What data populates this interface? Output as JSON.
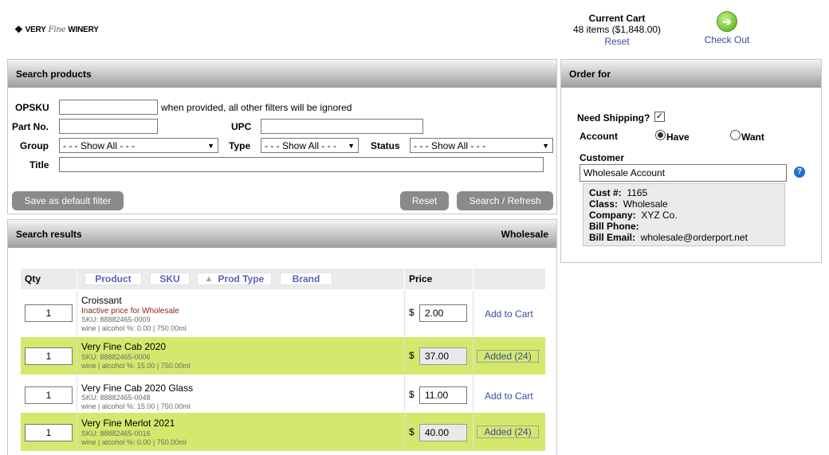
{
  "brand": {
    "logo_text_1": "VERY",
    "logo_text_2": "Fine",
    "logo_text_3": "WINERY"
  },
  "cart": {
    "title": "Current Cart",
    "summary": "48 items ($1,848.00)",
    "reset": "Reset"
  },
  "checkout": {
    "label": "Check Out",
    "icon": "arrow-right-circle-icon"
  },
  "search": {
    "title": "Search products",
    "opsku_label": "OPSKU",
    "opsku_value": "",
    "opsku_note": "when provided, all other filters will be ignored",
    "partno_label": "Part No.",
    "partno_value": "",
    "upc_label": "UPC",
    "upc_value": "",
    "group_label": "Group",
    "group_value": "- - - Show All - - -",
    "type_label": "Type",
    "type_value": "- - - Show All - - -",
    "status_label": "Status",
    "status_value": "- - - Show All - - -",
    "title_label": "Title",
    "title_value": "",
    "save_default": "Save as default filter",
    "reset": "Reset",
    "search_refresh": "Search / Refresh"
  },
  "results": {
    "title": "Search results",
    "pricing": "Wholesale",
    "columns": {
      "qty": "Qty",
      "product": "Product",
      "sku": "SKU",
      "prod_type": "Prod Type",
      "brand": "Brand",
      "price": "Price"
    },
    "rows": [
      {
        "qty": "1",
        "name": "Croissant",
        "note": "Inactive price for Wholesale",
        "sku": "SKU: 88882465-0009",
        "meta": "wine | alcohol %: 0.00 | 750.00ml",
        "currency": "$",
        "price": "2.00",
        "action": "Add to Cart"
      },
      {
        "qty": "1",
        "name": "Very Fine Cab 2020",
        "sku": "SKU: 88882465-0006",
        "meta": "wine | alcohol %: 15.00 | 750.00ml",
        "currency": "$",
        "price": "37.00",
        "action": "Added (24)"
      },
      {
        "qty": "1",
        "name": "Very Fine Cab 2020 Glass",
        "sku": "SKU: 88882465-0048",
        "meta": "wine | alcohol %: 15.00 | 750.00ml",
        "currency": "$",
        "price": "11.00",
        "action": "Add to Cart"
      },
      {
        "qty": "1",
        "name": "Very Fine Merlot 2021",
        "sku": "SKU: 88882465-0016",
        "meta": "wine | alcohol %: 0.00 | 750.00ml",
        "currency": "$",
        "price": "40.00",
        "action": "Added (24)"
      }
    ]
  },
  "order": {
    "title": "Order for",
    "need_shipping_label": "Need Shipping?",
    "need_shipping_checked": true,
    "account_label": "Account",
    "account_have": "Have",
    "account_want": "Want",
    "customer_label": "Customer",
    "customer_value": "Wholesale Account",
    "cust_num_label": "Cust #:",
    "cust_num": "1165",
    "class_label": "Class:",
    "class_value": "Wholesale",
    "company_label": "Company:",
    "company_value": "XYZ Co.",
    "bill_phone_label": "Bill Phone:",
    "bill_phone_value": "",
    "bill_email_label": "Bill Email:",
    "bill_email_value": "wholesale@orderport.net"
  }
}
